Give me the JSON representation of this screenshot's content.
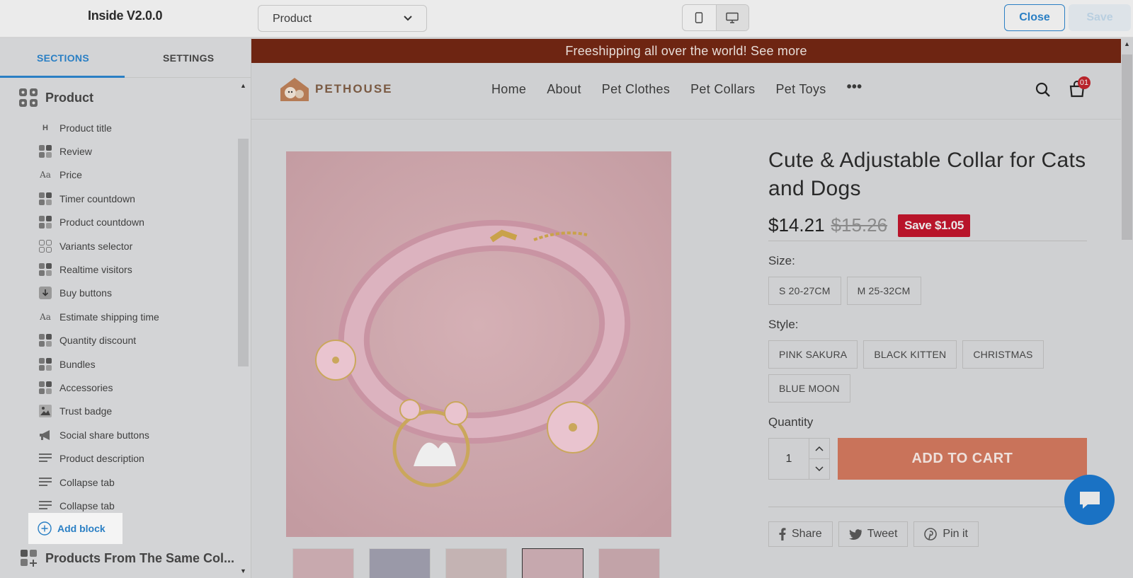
{
  "app": {
    "title": "Inside V2.0.0"
  },
  "toolbar": {
    "page_select": "Product",
    "close_label": "Close",
    "save_label": "Save",
    "devices": [
      "mobile-icon",
      "desktop-icon"
    ]
  },
  "sidebar": {
    "tabs": [
      {
        "label": "SECTIONS"
      },
      {
        "label": "SETTINGS"
      }
    ],
    "section": {
      "label": "Product"
    },
    "blocks": [
      {
        "label": "Product title",
        "icon": "heading-icon"
      },
      {
        "label": "Review",
        "icon": "app-block-icon"
      },
      {
        "label": "Price",
        "icon": "text-icon"
      },
      {
        "label": "Timer countdown",
        "icon": "app-block-icon"
      },
      {
        "label": "Product countdown",
        "icon": "app-block-icon"
      },
      {
        "label": "Variants selector",
        "icon": "grid-icon"
      },
      {
        "label": "Realtime visitors",
        "icon": "app-block-icon"
      },
      {
        "label": "Buy buttons",
        "icon": "download-icon"
      },
      {
        "label": "Estimate shipping time",
        "icon": "text-icon"
      },
      {
        "label": "Quantity discount",
        "icon": "app-block-icon"
      },
      {
        "label": "Bundles",
        "icon": "app-block-icon"
      },
      {
        "label": "Accessories",
        "icon": "app-block-icon"
      },
      {
        "label": "Trust badge",
        "icon": "image-icon"
      },
      {
        "label": "Social share buttons",
        "icon": "megaphone-icon"
      },
      {
        "label": "Product description",
        "icon": "paragraph-icon"
      },
      {
        "label": "Collapse tab",
        "icon": "paragraph-icon"
      },
      {
        "label": "Collapse tab",
        "icon": "paragraph-icon"
      }
    ],
    "add_block_label": "Add block",
    "next_section_label": "Products From The Same Col..."
  },
  "store": {
    "announcement": "Freeshipping all over the world! See more",
    "logo_text": "PETHOUSE",
    "nav": [
      "Home",
      "About",
      "Pet Clothes",
      "Pet Collars",
      "Pet Toys"
    ],
    "cart_count": "01"
  },
  "product": {
    "title": "Cute & Adjustable Collar for Cats and Dogs",
    "price": "$14.21",
    "compare_price": "$15.26",
    "save_badge": "Save $1.05",
    "size_label": "Size:",
    "sizes": [
      "S 20-27CM",
      "M 25-32CM"
    ],
    "style_label": "Style:",
    "styles": [
      "PINK SAKURA",
      "BLACK KITTEN",
      "CHRISTMAS",
      "BLUE MOON"
    ],
    "quantity_label": "Quantity",
    "quantity": "1",
    "add_to_cart": "ADD TO CART",
    "share": [
      "Share",
      "Tweet",
      "Pin it"
    ]
  },
  "colors": {
    "accent": "#2a7fc4",
    "announcement_bg": "#6e2512",
    "save_badge": "#b8142a",
    "add_to_cart": "#c9735a",
    "chat": "#1a72c4"
  }
}
